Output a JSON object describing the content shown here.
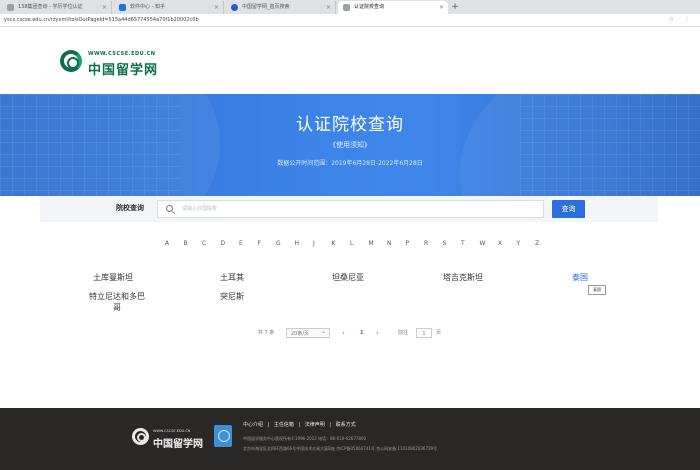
{
  "browser": {
    "tabs": [
      {
        "title": "138集团查询 - 学历学位认证"
      },
      {
        "title": "软件中心 - 知乎"
      },
      {
        "title": "中国留学网_首页搜索"
      },
      {
        "title": "认证院校查询",
        "active": true
      }
    ],
    "new_tab": "+",
    "url": "yscx.cscse.edu.cn/rzyxml/toIsOutPageId=515a44d65774554a70f1b20002c0b"
  },
  "header": {
    "logo_domain": "WWW.CSCSE.EDU.CN",
    "logo_name": "中国留学网"
  },
  "banner": {
    "title": "认证院校查询",
    "notice": "《使用须知》",
    "range": "数据公开时间范围：2019年6月28日-2022年6月28日"
  },
  "search": {
    "label": "院校查询",
    "placeholder": "请输入外国院校",
    "value": "",
    "button": "查询"
  },
  "alphabet": [
    "A",
    "B",
    "C",
    "D",
    "E",
    "F",
    "G",
    "H",
    "J",
    "K",
    "L",
    "M",
    "N",
    "P",
    "R",
    "S",
    "T",
    "W",
    "X",
    "Y",
    "Z"
  ],
  "results": [
    {
      "name": "土库曼斯坦"
    },
    {
      "name": "土耳其"
    },
    {
      "name": "坦桑尼亚"
    },
    {
      "name": "塔吉克斯坦"
    },
    {
      "name": "泰国",
      "highlighted": true
    },
    {
      "name": "特立尼达和多巴哥"
    },
    {
      "name": "突尼斯"
    }
  ],
  "tooltip": "泰国",
  "pagination": {
    "total": "共 7 条",
    "page_size": "20条/页",
    "prev": "‹",
    "current": "1",
    "next": "›",
    "goto_label": "前往",
    "goto_value": "1",
    "goto_suffix": "页"
  },
  "footer": {
    "logo_domain": "WWW.CSCSE.EDU.CN",
    "logo_name": "中国留学网",
    "links": [
      "中心介绍",
      "主任信箱",
      "法律声明",
      "联系方式"
    ],
    "separator": "|",
    "line1": "中国留学服务中心版权所有©1996-2022   电话：86-010-62677800",
    "line2": "北京市海淀区北四环西路66号中国技术交易大厦B座   京ICP备05064741号   京公网安备:11010802036729号"
  },
  "colors": {
    "brand_green": "#0b6e4f",
    "banner_blue": "#3b82e6",
    "button_blue": "#2a6fdb",
    "footer_bg": "#2a2727"
  }
}
